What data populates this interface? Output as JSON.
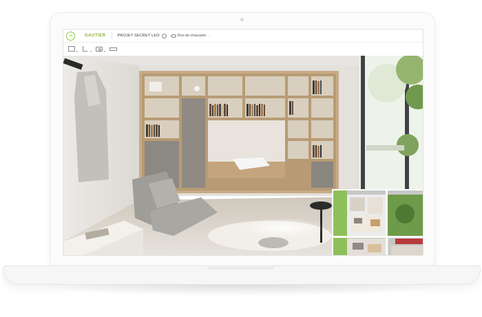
{
  "app": {
    "brand": "GAUTIER",
    "project_title": "PROJET SECRET LEO",
    "floor_label": "Rez-de-chaussée",
    "brand_color": "#8ab02d"
  },
  "icons": {
    "logo": "house-logo-icon",
    "info": "info-icon",
    "view": "eye-icon",
    "toolbar": [
      "frame-tool-icon",
      "tree-tool-icon",
      "camera-tool-icon",
      "ruler-tool-icon"
    ]
  },
  "scene": {
    "description_colors": {
      "wall": "#e9e7e2",
      "wood": "#c9a982",
      "sofa": "#b8b8b0",
      "floor": "#dcd7ce"
    }
  }
}
